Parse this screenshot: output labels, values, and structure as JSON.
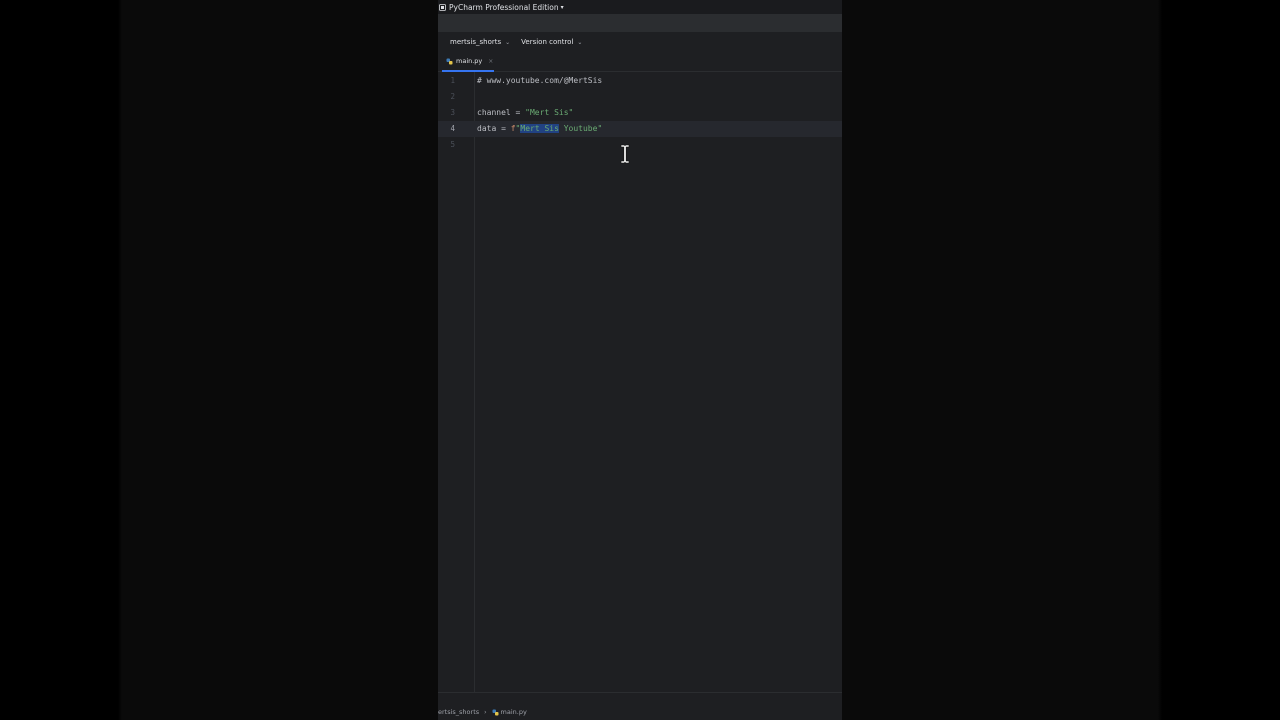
{
  "titlebar": {
    "app_name": "PyCharm Professional Edition",
    "caret": "▾"
  },
  "toolbar": {
    "project": "mertsis_shorts",
    "vcs": "Version control",
    "chevron": "⌄"
  },
  "tabs": [
    {
      "label": "main.py",
      "close": "×",
      "active": true
    }
  ],
  "editor": {
    "lines": [
      {
        "num": "1",
        "text": "# www.youtube.com/@MertSis"
      },
      {
        "num": "2",
        "text": ""
      },
      {
        "num": "3",
        "prefix": "channel = ",
        "string": "\"Mert Sis\""
      },
      {
        "num": "4",
        "prefix": "data = ",
        "fprefix": "f",
        "quote_open": "\"",
        "selected": "Mert Sis",
        "rest": " Youtube\""
      },
      {
        "num": "5",
        "text": ""
      }
    ],
    "current_line": "4"
  },
  "statusbar": {
    "project": "ertsis_shorts",
    "separator": "›",
    "file": "main.py"
  },
  "colors": {
    "background": "#1e1f22",
    "accent": "#3574f0",
    "string": "#6aab73",
    "comment": "#7a7e85",
    "selection": "#214283",
    "keyword": "#cf8e6d"
  },
  "icons": {
    "app": "pycharm-app-icon",
    "python_file": "python-file-icon",
    "text_cursor": "ibeam-cursor-icon"
  }
}
